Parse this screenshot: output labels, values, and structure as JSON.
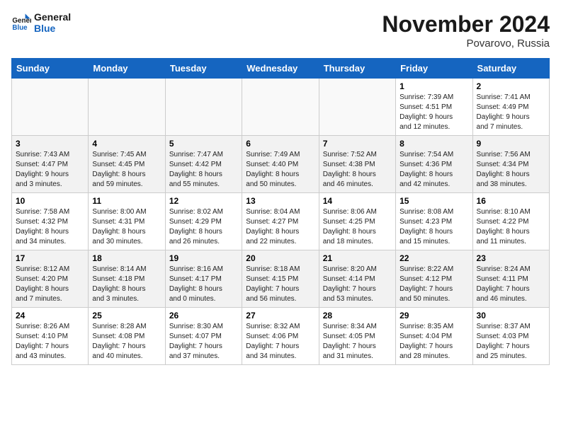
{
  "logo": {
    "line1": "General",
    "line2": "Blue"
  },
  "title": "November 2024",
  "location": "Povarovo, Russia",
  "days_of_week": [
    "Sunday",
    "Monday",
    "Tuesday",
    "Wednesday",
    "Thursday",
    "Friday",
    "Saturday"
  ],
  "weeks": [
    [
      {
        "day": "",
        "info": ""
      },
      {
        "day": "",
        "info": ""
      },
      {
        "day": "",
        "info": ""
      },
      {
        "day": "",
        "info": ""
      },
      {
        "day": "",
        "info": ""
      },
      {
        "day": "1",
        "info": "Sunrise: 7:39 AM\nSunset: 4:51 PM\nDaylight: 9 hours\nand 12 minutes."
      },
      {
        "day": "2",
        "info": "Sunrise: 7:41 AM\nSunset: 4:49 PM\nDaylight: 9 hours\nand 7 minutes."
      }
    ],
    [
      {
        "day": "3",
        "info": "Sunrise: 7:43 AM\nSunset: 4:47 PM\nDaylight: 9 hours\nand 3 minutes."
      },
      {
        "day": "4",
        "info": "Sunrise: 7:45 AM\nSunset: 4:45 PM\nDaylight: 8 hours\nand 59 minutes."
      },
      {
        "day": "5",
        "info": "Sunrise: 7:47 AM\nSunset: 4:42 PM\nDaylight: 8 hours\nand 55 minutes."
      },
      {
        "day": "6",
        "info": "Sunrise: 7:49 AM\nSunset: 4:40 PM\nDaylight: 8 hours\nand 50 minutes."
      },
      {
        "day": "7",
        "info": "Sunrise: 7:52 AM\nSunset: 4:38 PM\nDaylight: 8 hours\nand 46 minutes."
      },
      {
        "day": "8",
        "info": "Sunrise: 7:54 AM\nSunset: 4:36 PM\nDaylight: 8 hours\nand 42 minutes."
      },
      {
        "day": "9",
        "info": "Sunrise: 7:56 AM\nSunset: 4:34 PM\nDaylight: 8 hours\nand 38 minutes."
      }
    ],
    [
      {
        "day": "10",
        "info": "Sunrise: 7:58 AM\nSunset: 4:32 PM\nDaylight: 8 hours\nand 34 minutes."
      },
      {
        "day": "11",
        "info": "Sunrise: 8:00 AM\nSunset: 4:31 PM\nDaylight: 8 hours\nand 30 minutes."
      },
      {
        "day": "12",
        "info": "Sunrise: 8:02 AM\nSunset: 4:29 PM\nDaylight: 8 hours\nand 26 minutes."
      },
      {
        "day": "13",
        "info": "Sunrise: 8:04 AM\nSunset: 4:27 PM\nDaylight: 8 hours\nand 22 minutes."
      },
      {
        "day": "14",
        "info": "Sunrise: 8:06 AM\nSunset: 4:25 PM\nDaylight: 8 hours\nand 18 minutes."
      },
      {
        "day": "15",
        "info": "Sunrise: 8:08 AM\nSunset: 4:23 PM\nDaylight: 8 hours\nand 15 minutes."
      },
      {
        "day": "16",
        "info": "Sunrise: 8:10 AM\nSunset: 4:22 PM\nDaylight: 8 hours\nand 11 minutes."
      }
    ],
    [
      {
        "day": "17",
        "info": "Sunrise: 8:12 AM\nSunset: 4:20 PM\nDaylight: 8 hours\nand 7 minutes."
      },
      {
        "day": "18",
        "info": "Sunrise: 8:14 AM\nSunset: 4:18 PM\nDaylight: 8 hours\nand 3 minutes."
      },
      {
        "day": "19",
        "info": "Sunrise: 8:16 AM\nSunset: 4:17 PM\nDaylight: 8 hours\nand 0 minutes."
      },
      {
        "day": "20",
        "info": "Sunrise: 8:18 AM\nSunset: 4:15 PM\nDaylight: 7 hours\nand 56 minutes."
      },
      {
        "day": "21",
        "info": "Sunrise: 8:20 AM\nSunset: 4:14 PM\nDaylight: 7 hours\nand 53 minutes."
      },
      {
        "day": "22",
        "info": "Sunrise: 8:22 AM\nSunset: 4:12 PM\nDaylight: 7 hours\nand 50 minutes."
      },
      {
        "day": "23",
        "info": "Sunrise: 8:24 AM\nSunset: 4:11 PM\nDaylight: 7 hours\nand 46 minutes."
      }
    ],
    [
      {
        "day": "24",
        "info": "Sunrise: 8:26 AM\nSunset: 4:10 PM\nDaylight: 7 hours\nand 43 minutes."
      },
      {
        "day": "25",
        "info": "Sunrise: 8:28 AM\nSunset: 4:08 PM\nDaylight: 7 hours\nand 40 minutes."
      },
      {
        "day": "26",
        "info": "Sunrise: 8:30 AM\nSunset: 4:07 PM\nDaylight: 7 hours\nand 37 minutes."
      },
      {
        "day": "27",
        "info": "Sunrise: 8:32 AM\nSunset: 4:06 PM\nDaylight: 7 hours\nand 34 minutes."
      },
      {
        "day": "28",
        "info": "Sunrise: 8:34 AM\nSunset: 4:05 PM\nDaylight: 7 hours\nand 31 minutes."
      },
      {
        "day": "29",
        "info": "Sunrise: 8:35 AM\nSunset: 4:04 PM\nDaylight: 7 hours\nand 28 minutes."
      },
      {
        "day": "30",
        "info": "Sunrise: 8:37 AM\nSunset: 4:03 PM\nDaylight: 7 hours\nand 25 minutes."
      }
    ]
  ]
}
